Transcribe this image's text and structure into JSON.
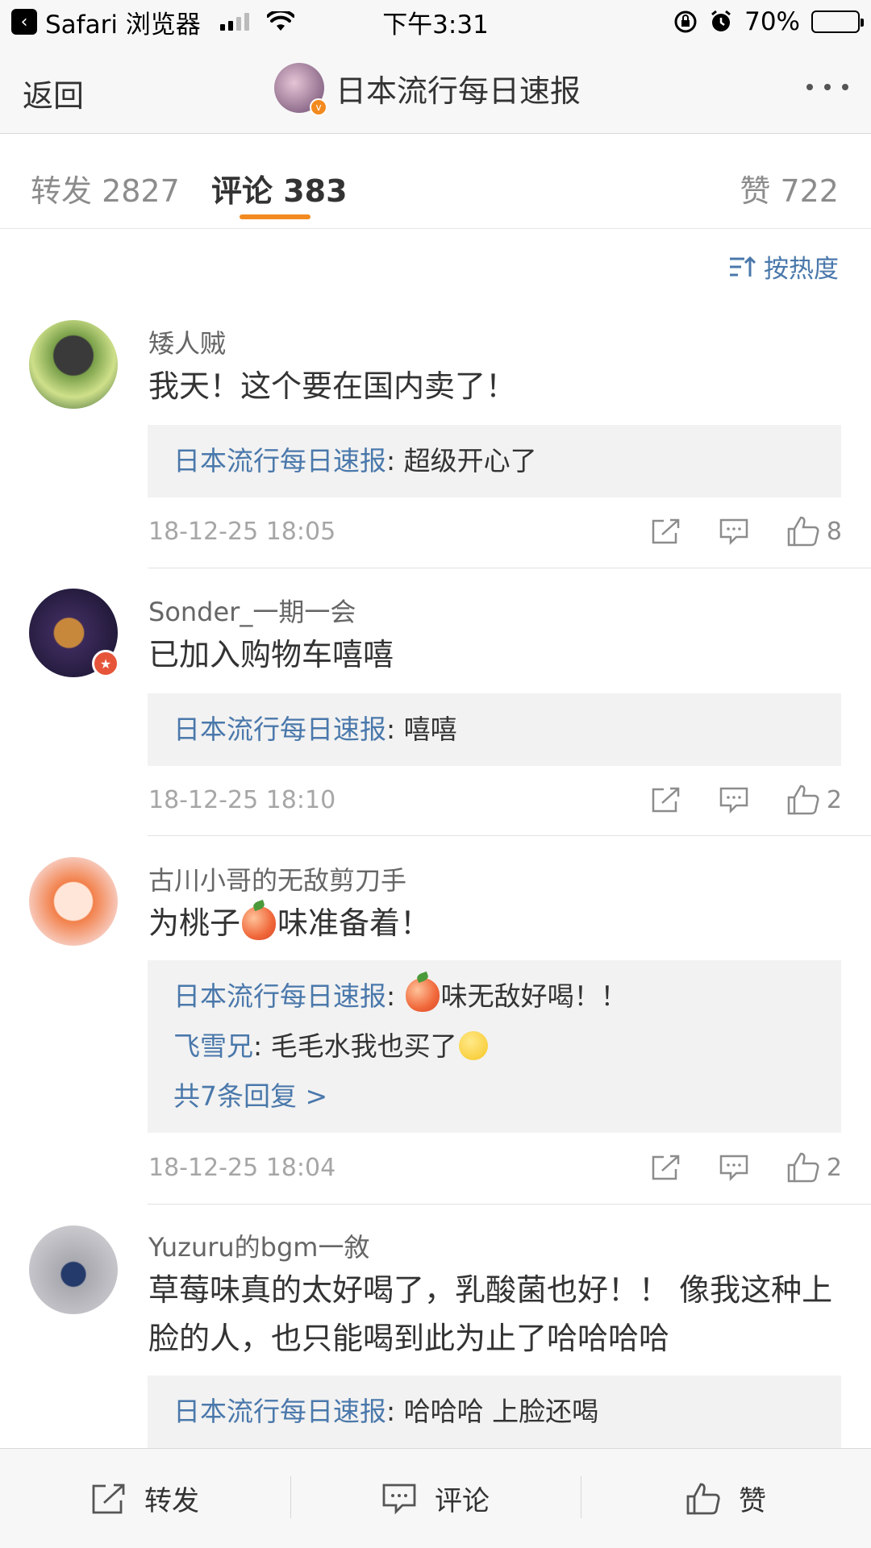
{
  "status_bar": {
    "back_app": "Safari 浏览器",
    "time": "下午3:31",
    "battery": "70%",
    "battery_level": 0.7
  },
  "nav": {
    "back": "返回",
    "title": "日本流行每日速报"
  },
  "tabs": {
    "repost": "转发 2827",
    "comments": "评论 383",
    "likes": "赞 722"
  },
  "sort": {
    "label": "按热度"
  },
  "comments": [
    {
      "user": "矮人贼",
      "text": "我天！这个要在国内卖了！",
      "replies": [
        {
          "author": "日本流行每日速报",
          "sep": ": ",
          "text": "超级开心了"
        }
      ],
      "time": "18-12-25 18:05",
      "likes": "8"
    },
    {
      "user": "Sonder_一期一会",
      "text": "已加入购物车嘻嘻",
      "replies": [
        {
          "author": "日本流行每日速报",
          "sep": ": ",
          "text": "嘻嘻"
        }
      ],
      "time": "18-12-25 18:10",
      "likes": "2"
    },
    {
      "user": "古川小哥的无敌剪刀手",
      "text_a": "为桃子",
      "text_b": "味准备着！",
      "replies": [
        {
          "author": "日本流行每日速报",
          "sep": ": ",
          "text": "味无敌好喝！！"
        },
        {
          "author": "飞雪兄",
          "sep": ": ",
          "text": "毛毛水我也买了"
        }
      ],
      "more": "共7条回复 >",
      "time": "18-12-25 18:04",
      "likes": "2"
    },
    {
      "user": "Yuzuru的bgm一敘",
      "text": "草莓味真的太好喝了，乳酸菌也好！！ 像我这种上脸的人，也只能喝到此为止了哈哈哈哈",
      "replies": [
        {
          "author": "日本流行每日速报",
          "sep": ": ",
          "text": "哈哈哈 上脸还喝"
        }
      ]
    }
  ],
  "bottom_bar": {
    "repost": "转发",
    "comment": "评论",
    "like": "赞"
  },
  "colors": {
    "accent": "#f38a1f",
    "link": "#4a78ab",
    "reply_bg": "#f2f2f2"
  }
}
